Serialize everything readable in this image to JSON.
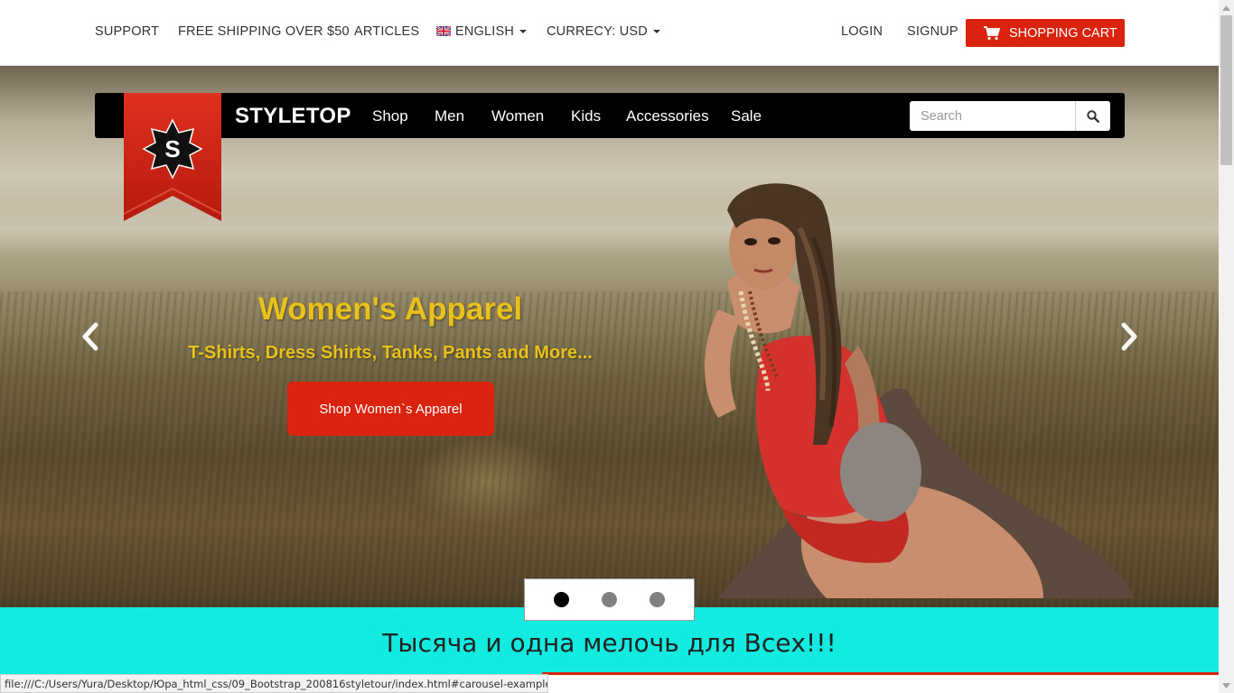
{
  "topbar": {
    "support": "SUPPORT",
    "shipping": "FREE SHIPPING OVER $50",
    "articles": "ARTICLES",
    "language": "ENGLISH",
    "currency": "CURRECY: USD",
    "login": "LOGIN",
    "signup": "SIGNUP",
    "cart": "SHOPPING CART"
  },
  "navbar": {
    "brand": "STYLETOP",
    "logo_letter": "S",
    "items": [
      "Shop",
      "Men",
      "Women",
      "Kids",
      "Accessories",
      "Sale"
    ],
    "search_placeholder": "Search"
  },
  "slide": {
    "title": "Women's Apparel",
    "subtitle": "T-Shirts, Dress Shirts, Tanks, Pants and More...",
    "button": "Shop Women`s Apparel",
    "indicators": 3,
    "active_index": 0
  },
  "tagline": "Тысяча и одна мелочь для Всех!!!",
  "status_bar": "file:///C:/Users/Yura/Desktop/Юра_html_css/09_Bootstrap_200816styletour/index.html#carousel-example-generic",
  "colors": {
    "accent_red": "#d9230f",
    "caption_yellow": "#e8c21a",
    "tagline_bg": "#12ebdf",
    "navbar_bg": "#000000"
  },
  "icons": {
    "cart": "cart-icon",
    "flag": "uk-flag-icon",
    "search": "search-icon",
    "prev": "chevron-left-icon",
    "next": "chevron-right-icon"
  }
}
